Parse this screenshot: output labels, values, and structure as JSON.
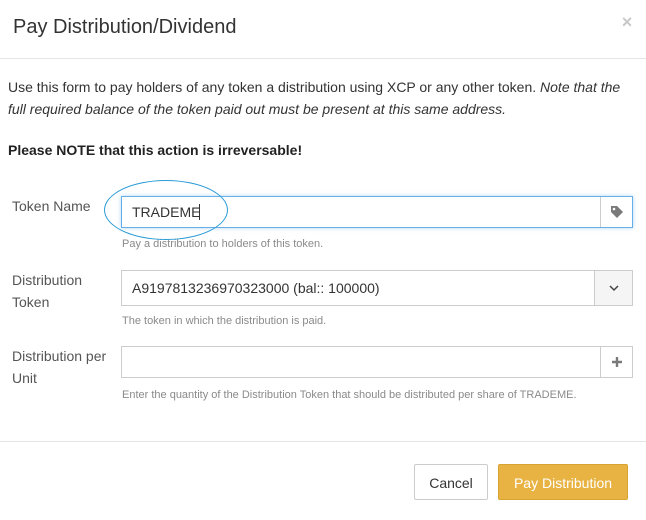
{
  "dialog": {
    "title": "Pay Distribution/Dividend",
    "close_glyph": "×"
  },
  "intro": {
    "text": "Use this form to pay holders of any token a distribution using XCP or any other token. ",
    "note": "Note that the full required balance of the token paid out must be present at this same address."
  },
  "notice": "Please NOTE that this action is irreversable!",
  "fields": {
    "token_name": {
      "label": "Token Name",
      "value": "TRADEME",
      "help": "Pay a distribution to holders of this token.",
      "icon": "tag-icon"
    },
    "distribution_token": {
      "label": "Distribution Token",
      "value": "A9197813236970323000 (bal:: 100000)",
      "help": "The token in which the distribution is paid.",
      "icon": "chevron-down-icon"
    },
    "distribution_per_unit": {
      "label": "Distribution per Unit",
      "value": "",
      "help": "Enter the quantity of the Distribution Token that should be distributed per share of TRADEME.",
      "icon": "plus-icon"
    }
  },
  "footer": {
    "cancel_label": "Cancel",
    "submit_label": "Pay Distribution"
  },
  "colors": {
    "primary_button": "#e8b343",
    "focus_border": "#66afe9",
    "annotation_circle": "#2a9bd6"
  }
}
